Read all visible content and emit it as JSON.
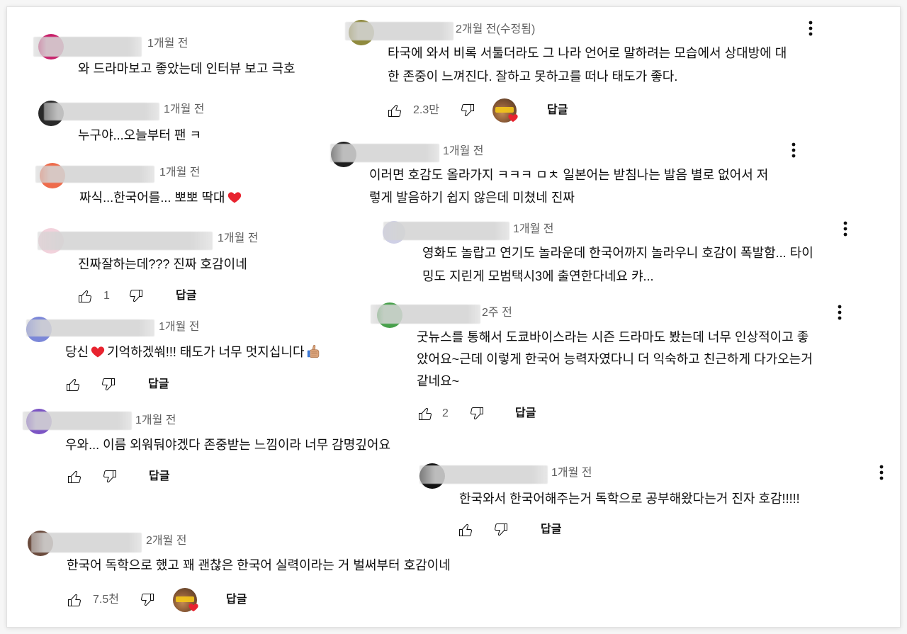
{
  "colors": {
    "text": "#0f0f0f",
    "meta_text": "#606060",
    "icon": "#0f0f0f",
    "heart": "#e8232f",
    "thumb_emoji_skin": "#dca57c",
    "card_background": "#ffffff"
  },
  "labels": {
    "reply": "답글"
  },
  "left_column": [
    {
      "time": "1개월 전",
      "text": "와 드라마보고 좋았는데 인터뷰 보고 극호",
      "avatar_color": "#c8206a"
    },
    {
      "time": "1개월 전",
      "text": "누구야...오늘부터 팬 ㅋ",
      "avatar_color": "#2a2a2a"
    },
    {
      "time": "1개월 전",
      "text": "짜식...한국어를... 뽀뽀 딱대",
      "emoji_icon": "red-heart-emoji",
      "avatar_color": "#ee6b4b"
    },
    {
      "time": "1개월 전",
      "text": "진짜잘하는데??? 진짜 호감이네",
      "avatar_color": "#f2d2dc",
      "likes": "1"
    },
    {
      "time": "1개월 전",
      "text_before_emoji": "당신",
      "text_after_emoji": "기억하겠쒀!!! 태도가 너무 멋지십니다",
      "emoji_icons": [
        "red-heart-emoji",
        "thumbs-up-emoji"
      ],
      "avatar_color": "#7b87d8"
    },
    {
      "time": "1개월 전",
      "text": "우와... 이름 외워둬야겠다 존중받는 느낌이라 너무 감명깊어요",
      "avatar_color": "#7c55c4"
    },
    {
      "time": "2개월 전",
      "text": "한국어 독학으로 했고 꽤 괜찮은 한국어 실력이라는 거 벌써부터 호감이네",
      "avatar_color": "#6a4a3c",
      "likes": "7.5천",
      "creator_heart": true
    }
  ],
  "right_column": [
    {
      "time": "2개월 전(수정됨)",
      "lines": [
        "타국에 와서 비록 서툴더라도 그 나라 언어로 말하려는 모습에서 상대방에 대",
        "한 존중이 느껴진다. 잘하고 못하고를 떠나 태도가 좋다."
      ],
      "avatar_color": "#8f8a3e",
      "likes": "2.3만",
      "creator_heart": true
    },
    {
      "time": "1개월 전",
      "lines": [
        "이러면 호감도 올라가지 ㅋㅋㅋ ㅁㅊ 일본어는 받침나는 발음 별로 없어서 저",
        "렇게 발음하기 쉽지 않은데 미쳤네 진짜"
      ],
      "avatar_color": "#1f1f1f"
    },
    {
      "time": "1개월 전",
      "lines": [
        "영화도 놀랍고 연기도 놀라운데 한국어까지 놀라우니 호감이 폭발함... 타이",
        "밍도 지린게 모범택시3에 출연한다네요 캬..."
      ],
      "avatar_color": "#cfd0e6"
    },
    {
      "time": "2주 전",
      "lines": [
        "굿뉴스를 통해서 도쿄바이스라는 시즌 드라마도 봤는데 너무 인상적이고 좋",
        "았어요~근데 이렇게 한국어 능력자였다니 더 익숙하고 친근하게 다가오는거",
        "같네요~"
      ],
      "avatar_color": "#46a04a",
      "likes": "2"
    },
    {
      "time": "1개월 전",
      "text": "한국와서 한국어해주는거 독학으로 공부해왔다는거 진자 호감!!!!!",
      "avatar_color": "#111111"
    }
  ]
}
